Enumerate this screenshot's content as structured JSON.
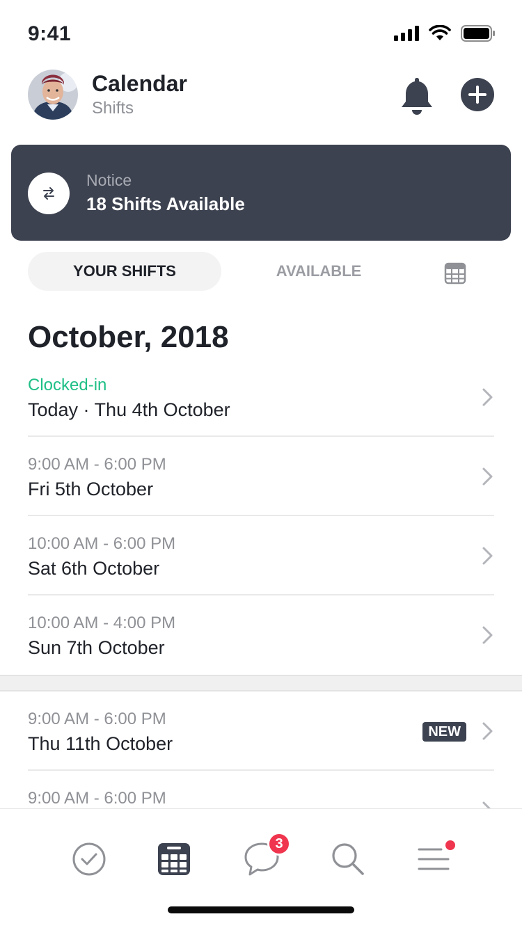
{
  "status_bar": {
    "time": "9:41",
    "icons": [
      "signal-icon",
      "wifi-icon",
      "battery-icon"
    ]
  },
  "header": {
    "title": "Calendar",
    "subtitle": "Shifts",
    "icons": [
      "bell-icon",
      "plus-icon"
    ]
  },
  "notice": {
    "label": "Notice",
    "text": "18 Shifts Available",
    "icon": "swap-arrows-icon"
  },
  "tabs": [
    {
      "label": "YOUR SHIFTS",
      "active": true
    },
    {
      "label": "AVAILABLE",
      "active": false
    },
    {
      "label": "",
      "icon": "calendar-grid-icon"
    }
  ],
  "month_title": "October, 2018",
  "shifts": [
    {
      "time": "Clocked-in",
      "date": "Today · Thu 4th October",
      "status": "clocked-in"
    },
    {
      "time": "9:00 AM - 6:00 PM",
      "date": "Fri 5th October"
    },
    {
      "time": "10:00 AM - 6:00 PM",
      "date": "Sat 6th October"
    },
    {
      "time": "10:00 AM - 4:00 PM",
      "date": "Sun 7th October"
    },
    {
      "time": "9:00 AM - 6:00 PM",
      "date": "Thu 11th October",
      "badge": "NEW"
    },
    {
      "time": "9:00 AM - 6:00 PM",
      "date": ""
    }
  ],
  "tabbar": {
    "items": [
      "check-circle-icon",
      "calendar-icon",
      "chat-bubble-icon",
      "search-icon",
      "menu-icon"
    ],
    "messages_count": "3"
  },
  "colors": {
    "dark": "#3d4250",
    "accent_green": "#1fbf86",
    "badge_red": "#f0354e"
  }
}
